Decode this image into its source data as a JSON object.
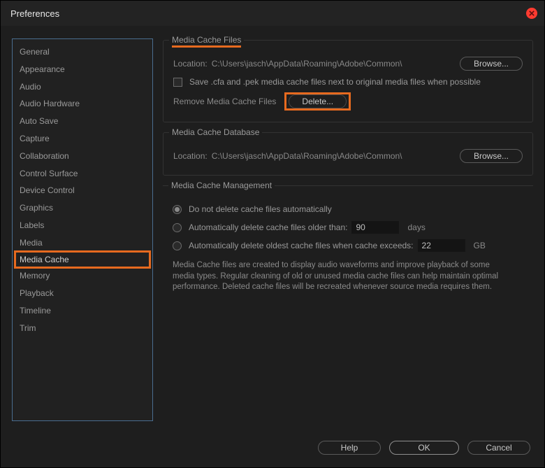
{
  "window": {
    "title": "Preferences"
  },
  "sidebar": {
    "items": [
      {
        "label": "General"
      },
      {
        "label": "Appearance"
      },
      {
        "label": "Audio"
      },
      {
        "label": "Audio Hardware"
      },
      {
        "label": "Auto Save"
      },
      {
        "label": "Capture"
      },
      {
        "label": "Collaboration"
      },
      {
        "label": "Control Surface"
      },
      {
        "label": "Device Control"
      },
      {
        "label": "Graphics"
      },
      {
        "label": "Labels"
      },
      {
        "label": "Media"
      },
      {
        "label": "Media Cache",
        "selected": true
      },
      {
        "label": "Memory"
      },
      {
        "label": "Playback"
      },
      {
        "label": "Timeline"
      },
      {
        "label": "Trim"
      }
    ]
  },
  "groups": {
    "files": {
      "title": "Media Cache Files",
      "location_label": "Location:",
      "location_path": "C:\\Users\\jasch\\AppData\\Roaming\\Adobe\\Common\\",
      "browse": "Browse...",
      "save_checkbox": "Save .cfa and .pek media cache files next to original media files when possible",
      "remove_label": "Remove Media Cache Files",
      "delete": "Delete..."
    },
    "db": {
      "title": "Media Cache Database",
      "location_label": "Location:",
      "location_path": "C:\\Users\\jasch\\AppData\\Roaming\\Adobe\\Common\\",
      "browse": "Browse..."
    },
    "mgmt": {
      "title": "Media Cache Management",
      "opt_no_delete": "Do not delete cache files automatically",
      "opt_older": "Automatically delete cache files older than:",
      "older_value": "90",
      "older_unit": "days",
      "opt_size": "Automatically delete oldest cache files when cache exceeds:",
      "size_value": "22",
      "size_unit": "GB",
      "description": "Media Cache files are created to display audio waveforms and improve playback of some media types.  Regular cleaning of old or unused media cache files can help maintain optimal performance. Deleted cache files will be recreated whenever source media requires them."
    }
  },
  "footer": {
    "help": "Help",
    "ok": "OK",
    "cancel": "Cancel"
  }
}
